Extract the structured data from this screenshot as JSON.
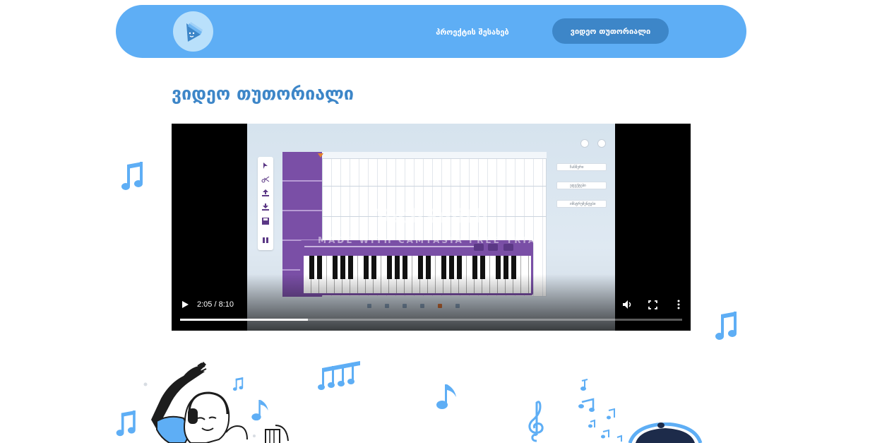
{
  "header": {
    "logo_icon": "book-play-logo",
    "nav": [
      {
        "label": "პროექტის შესახებ"
      },
      {
        "label": "ვიდეო თუთორიალი"
      }
    ]
  },
  "page_title": "ვიდეო თუთორიალი",
  "video": {
    "watermark_brand": "TechSmith",
    "watermark_text": "MADE WITH CAMTASIA FREE TRIAL",
    "time_display": "2:05 / 8:10",
    "progress_fraction": 0.2551,
    "side_buttons": [
      "ჩანწერი",
      "ეფექტები",
      "ინსტრუმენტები"
    ],
    "controls": {
      "play_icon": "play-icon",
      "volume_icon": "volume-icon",
      "fullscreen_icon": "fullscreen-icon",
      "more_icon": "more-options-icon"
    }
  },
  "colors": {
    "accent": "#5eaef5",
    "accent_dark": "#3d86c8",
    "logo_bg": "#b9e0fb",
    "app_purple": "#7a4fa6"
  }
}
